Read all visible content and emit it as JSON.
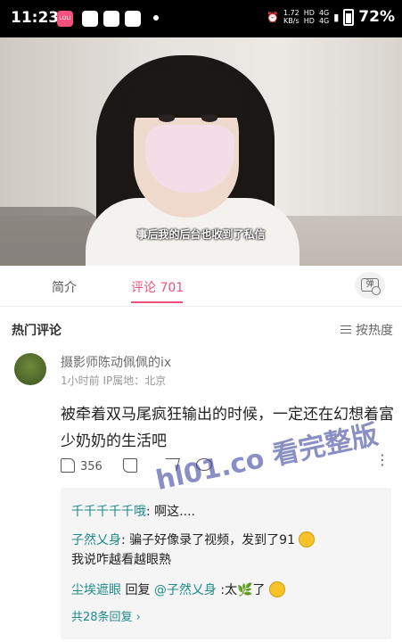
{
  "status_bar": {
    "time": "11:23",
    "net_speed_top": "1.72",
    "net_speed_bottom": "KB/s",
    "hd_top": "HD",
    "hd_bottom": "HD",
    "signal_top": "4G",
    "signal_bottom": "4G",
    "battery": "72%",
    "app_icon_label": "LOLI"
  },
  "video": {
    "subtitle": "事后我的后台也收到了私信"
  },
  "tabs": {
    "intro": "简介",
    "comments": "评论 701",
    "danmaku_toggle": "弹"
  },
  "comments_section": {
    "title": "热门评论",
    "sort_label": "按热度"
  },
  "comment": {
    "username": "摄影师陈动佩佩的ix",
    "meta": "1小时前  IP属地：北京",
    "text": "被牵着双马尾疯狂输出的时候，一定还在幻想着富少奶奶的生活吧",
    "like_count": "356",
    "more": "⋮"
  },
  "replies": [
    {
      "name": "千千千千千哦",
      "text": ": 啊这...."
    },
    {
      "name": "子然乂身",
      "text": ": 骗子好像录了视频，发到了91",
      "emoji": true,
      "line2": "我说咋越看越眼熟"
    },
    {
      "name": "尘埃遮眼",
      "reply_word": " 回复 ",
      "target": "@子然乂身",
      "text": " :太",
      "leaf": "🌿",
      "text2": "了",
      "emoji": true
    }
  ],
  "more_replies": "共28条回复 ›",
  "watermark": "hl01.co 看完整版",
  "colors": {
    "accent": "#f2507a",
    "reply_name": "#1f8a8a"
  }
}
